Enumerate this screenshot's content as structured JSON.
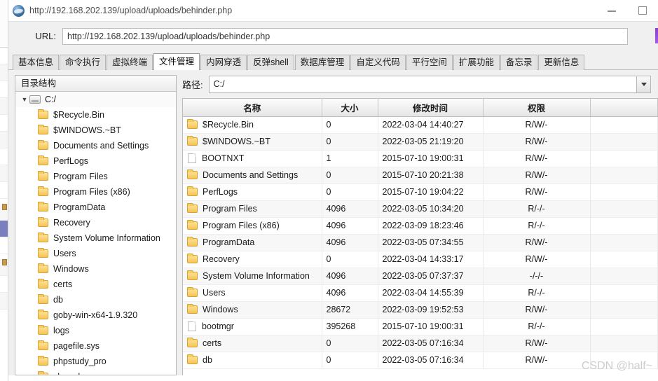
{
  "window": {
    "title": "http://192.168.202.139/upload/uploads/behinder.php",
    "icon": "globe-icon",
    "minimize_label": "—",
    "maximize_label": "□"
  },
  "urlbar": {
    "label": "URL:",
    "value": "http://192.168.202.139/upload/uploads/behinder.php",
    "placeholder": ""
  },
  "tabs": [
    {
      "label": "基本信息",
      "active": false
    },
    {
      "label": "命令执行",
      "active": false
    },
    {
      "label": "虚拟终端",
      "active": false
    },
    {
      "label": "文件管理",
      "active": true
    },
    {
      "label": "内网穿透",
      "active": false
    },
    {
      "label": "反弹shell",
      "active": false
    },
    {
      "label": "数据库管理",
      "active": false
    },
    {
      "label": "自定义代码",
      "active": false
    },
    {
      "label": "平行空间",
      "active": false
    },
    {
      "label": "扩展功能",
      "active": false
    },
    {
      "label": "备忘录",
      "active": false
    },
    {
      "label": "更新信息",
      "active": false
    }
  ],
  "tree": {
    "header": "目录结构",
    "root": {
      "label": "C:/",
      "icon": "drive-icon",
      "expanded": true,
      "caret": "▼"
    },
    "children": [
      {
        "label": "$Recycle.Bin",
        "icon": "folder-icon"
      },
      {
        "label": "$WINDOWS.~BT",
        "icon": "folder-icon"
      },
      {
        "label": "Documents and Settings",
        "icon": "folder-icon"
      },
      {
        "label": "PerfLogs",
        "icon": "folder-icon"
      },
      {
        "label": "Program Files",
        "icon": "folder-icon"
      },
      {
        "label": "Program Files (x86)",
        "icon": "folder-icon"
      },
      {
        "label": "ProgramData",
        "icon": "folder-icon"
      },
      {
        "label": "Recovery",
        "icon": "folder-icon"
      },
      {
        "label": "System Volume Information",
        "icon": "folder-icon"
      },
      {
        "label": "Users",
        "icon": "folder-icon"
      },
      {
        "label": "Windows",
        "icon": "folder-icon"
      },
      {
        "label": "certs",
        "icon": "folder-icon"
      },
      {
        "label": "db",
        "icon": "folder-icon"
      },
      {
        "label": "goby-win-x64-1.9.320",
        "icon": "folder-icon"
      },
      {
        "label": "logs",
        "icon": "folder-icon"
      },
      {
        "label": "pagefile.sys",
        "icon": "folder-icon"
      },
      {
        "label": "phpstudy_pro",
        "icon": "folder-icon"
      },
      {
        "label": "shared",
        "icon": "folder-icon"
      }
    ]
  },
  "path": {
    "label": "路径:",
    "value": "C:/",
    "dropdown_icon": "chevron-down-icon"
  },
  "table": {
    "headers": [
      "名称",
      "大小",
      "修改时间",
      "权限",
      ""
    ],
    "rows": [
      {
        "icon": "folder-icon",
        "name": "$Recycle.Bin",
        "size": "0",
        "modified": "2022-03-04 14:40:27",
        "perm": "R/W/-",
        "extra": ""
      },
      {
        "icon": "folder-icon",
        "name": "$WINDOWS.~BT",
        "size": "0",
        "modified": "2022-03-05 21:19:20",
        "perm": "R/W/-",
        "extra": ""
      },
      {
        "icon": "file-icon",
        "name": "BOOTNXT",
        "size": "1",
        "modified": "2015-07-10 19:00:31",
        "perm": "R/W/-",
        "extra": ""
      },
      {
        "icon": "folder-icon",
        "name": "Documents and Settings",
        "size": "0",
        "modified": "2015-07-10 20:21:38",
        "perm": "R/W/-",
        "extra": ""
      },
      {
        "icon": "folder-icon",
        "name": "PerfLogs",
        "size": "0",
        "modified": "2015-07-10 19:04:22",
        "perm": "R/W/-",
        "extra": ""
      },
      {
        "icon": "folder-icon",
        "name": "Program Files",
        "size": "4096",
        "modified": "2022-03-05 10:34:20",
        "perm": "R/-/-",
        "extra": ""
      },
      {
        "icon": "folder-icon",
        "name": "Program Files (x86)",
        "size": "4096",
        "modified": "2022-03-09 18:23:46",
        "perm": "R/-/-",
        "extra": ""
      },
      {
        "icon": "folder-icon",
        "name": "ProgramData",
        "size": "4096",
        "modified": "2022-03-05 07:34:55",
        "perm": "R/W/-",
        "extra": ""
      },
      {
        "icon": "folder-icon",
        "name": "Recovery",
        "size": "0",
        "modified": "2022-03-04 14:33:17",
        "perm": "R/W/-",
        "extra": ""
      },
      {
        "icon": "folder-icon",
        "name": "System Volume Information",
        "size": "4096",
        "modified": "2022-03-05 07:37:37",
        "perm": "-/-/-",
        "extra": ""
      },
      {
        "icon": "folder-icon",
        "name": "Users",
        "size": "4096",
        "modified": "2022-03-04 14:55:39",
        "perm": "R/-/-",
        "extra": ""
      },
      {
        "icon": "folder-icon",
        "name": "Windows",
        "size": "28672",
        "modified": "2022-03-09 19:52:53",
        "perm": "R/W/-",
        "extra": ""
      },
      {
        "icon": "file-icon",
        "name": "bootmgr",
        "size": "395268",
        "modified": "2015-07-10 19:00:31",
        "perm": "R/-/-",
        "extra": ""
      },
      {
        "icon": "folder-icon",
        "name": "certs",
        "size": "0",
        "modified": "2022-03-05 07:16:34",
        "perm": "R/W/-",
        "extra": ""
      },
      {
        "icon": "folder-icon",
        "name": "db",
        "size": "0",
        "modified": "2022-03-05 07:16:34",
        "perm": "R/W/-",
        "extra": ""
      }
    ]
  },
  "watermark": "CSDN @half~",
  "colors": {
    "tab_active_bg": "#ffffff",
    "tab_bg": "#e4e4e4",
    "panel_bg": "#f0f0f0",
    "folder_icon": "#f5c453",
    "accent_purple": "#a855f7",
    "selected_row": "#7a7fc0"
  }
}
